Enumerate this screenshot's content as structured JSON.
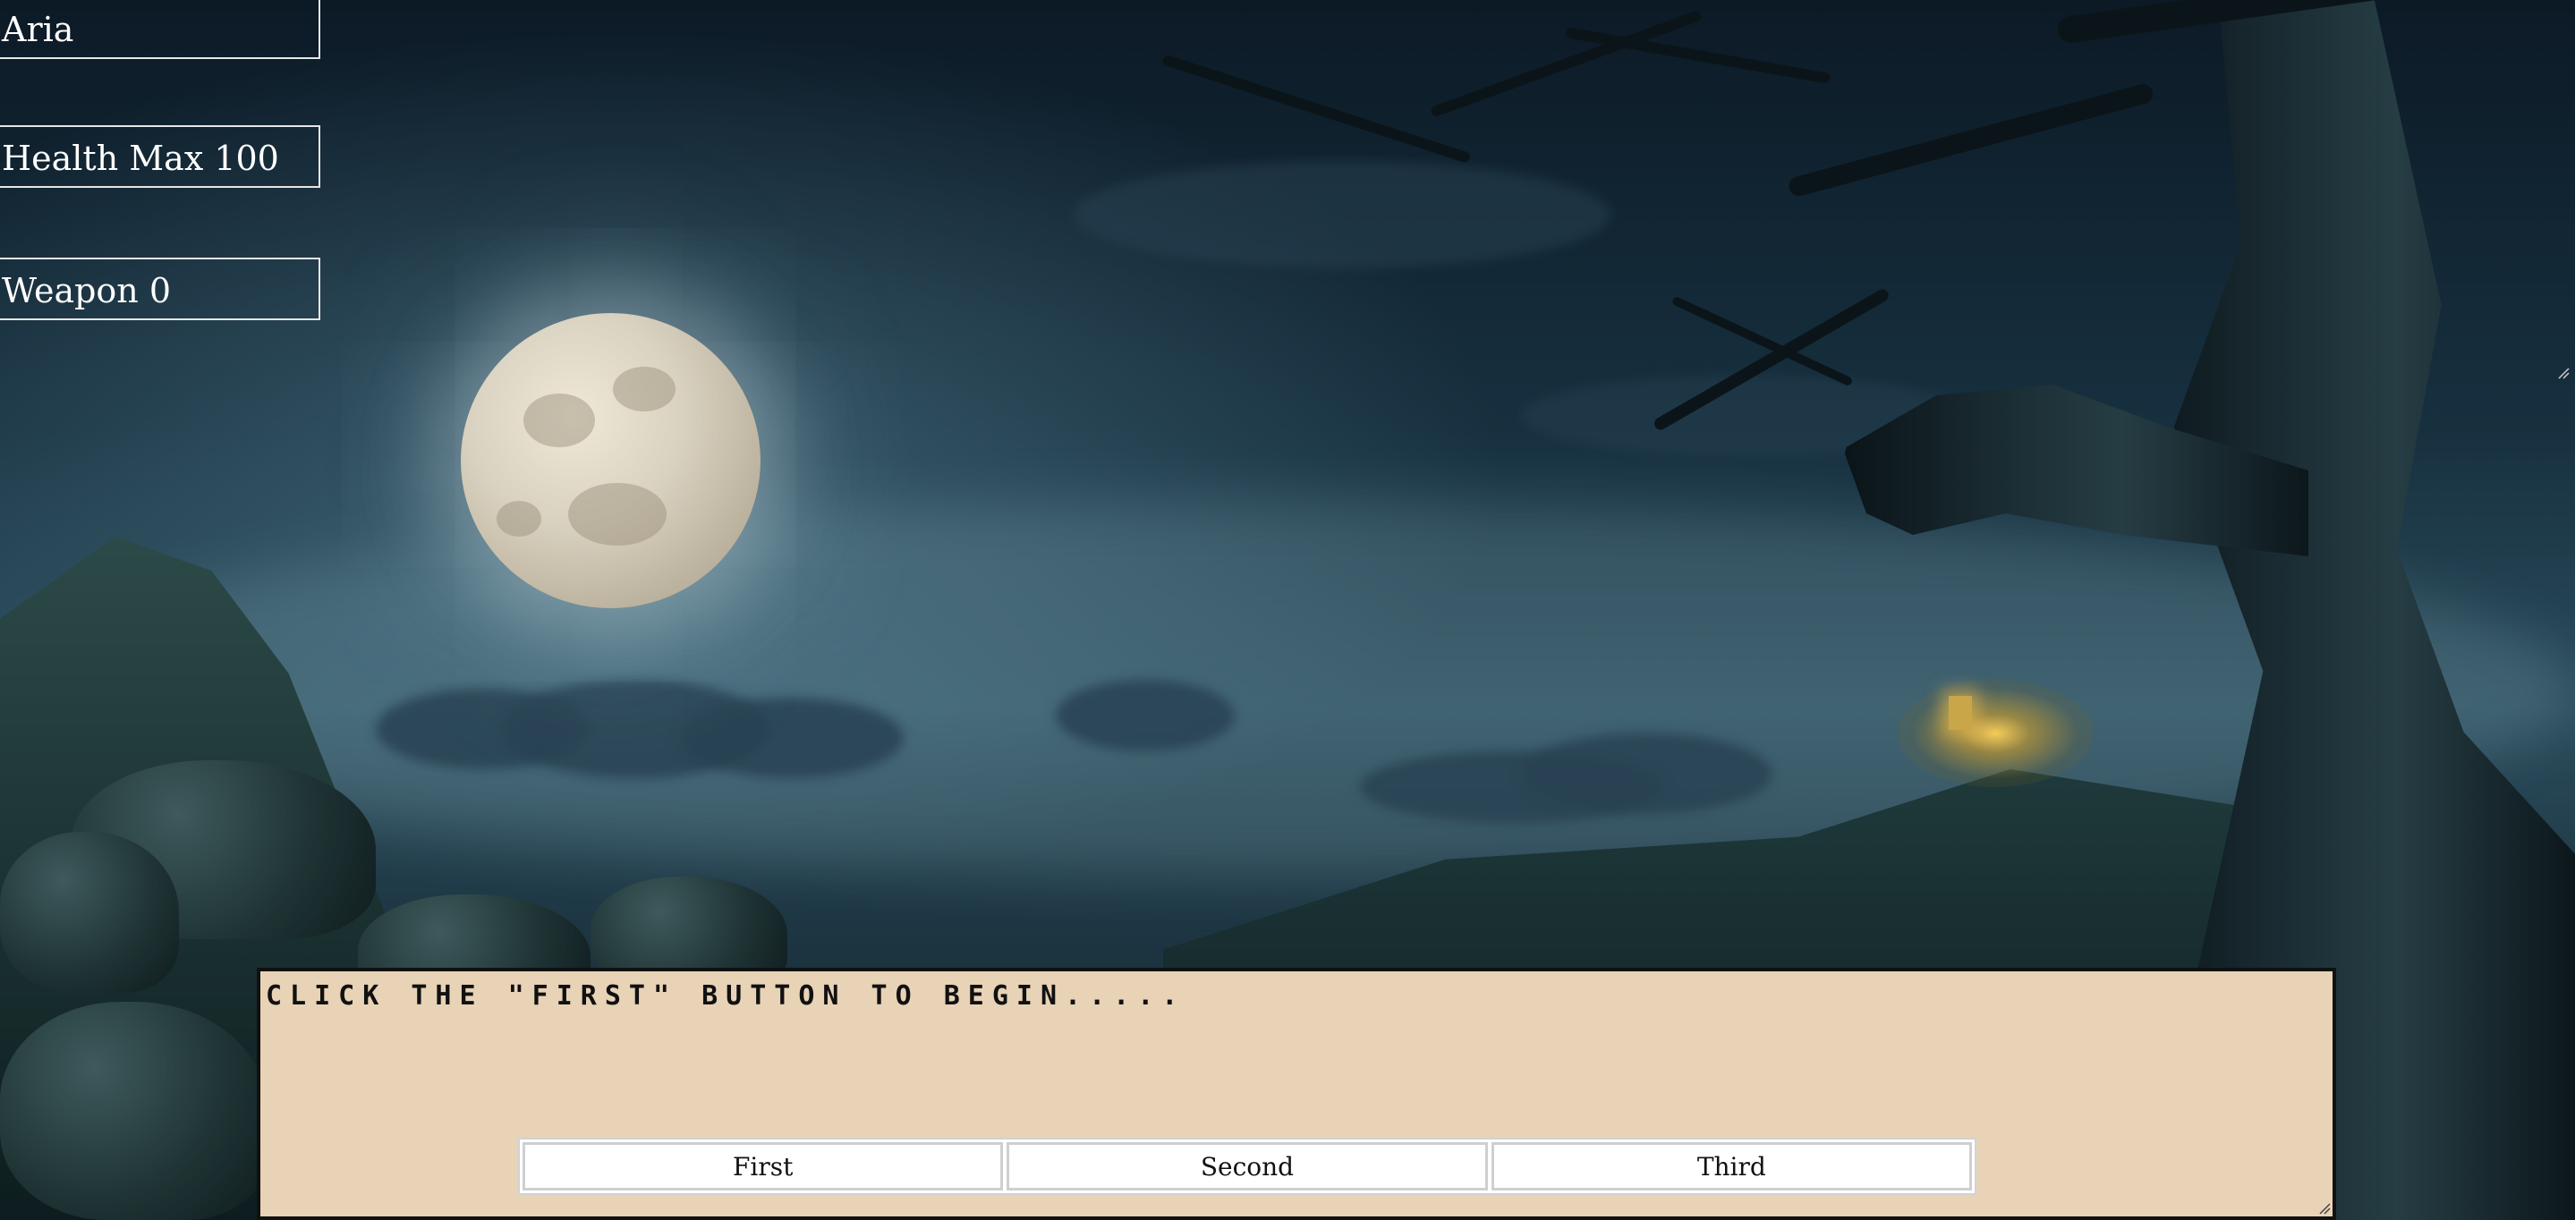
{
  "stats": {
    "name": "Aria",
    "health": "Health Max 100",
    "weapon": "Weapon 0"
  },
  "dialog": {
    "message": "CLICK THE \"FIRST\" BUTTON TO BEGIN....."
  },
  "buttons": {
    "first": "First",
    "second": "Second",
    "third": "Third"
  },
  "colors": {
    "dialog_bg": "#e8d3b6",
    "stat_text": "#ffffff",
    "stat_border": "#e6e6e6"
  },
  "icons": {
    "background": "night-landscape-moon-tree-image",
    "resize": "resize-grip-icon"
  }
}
